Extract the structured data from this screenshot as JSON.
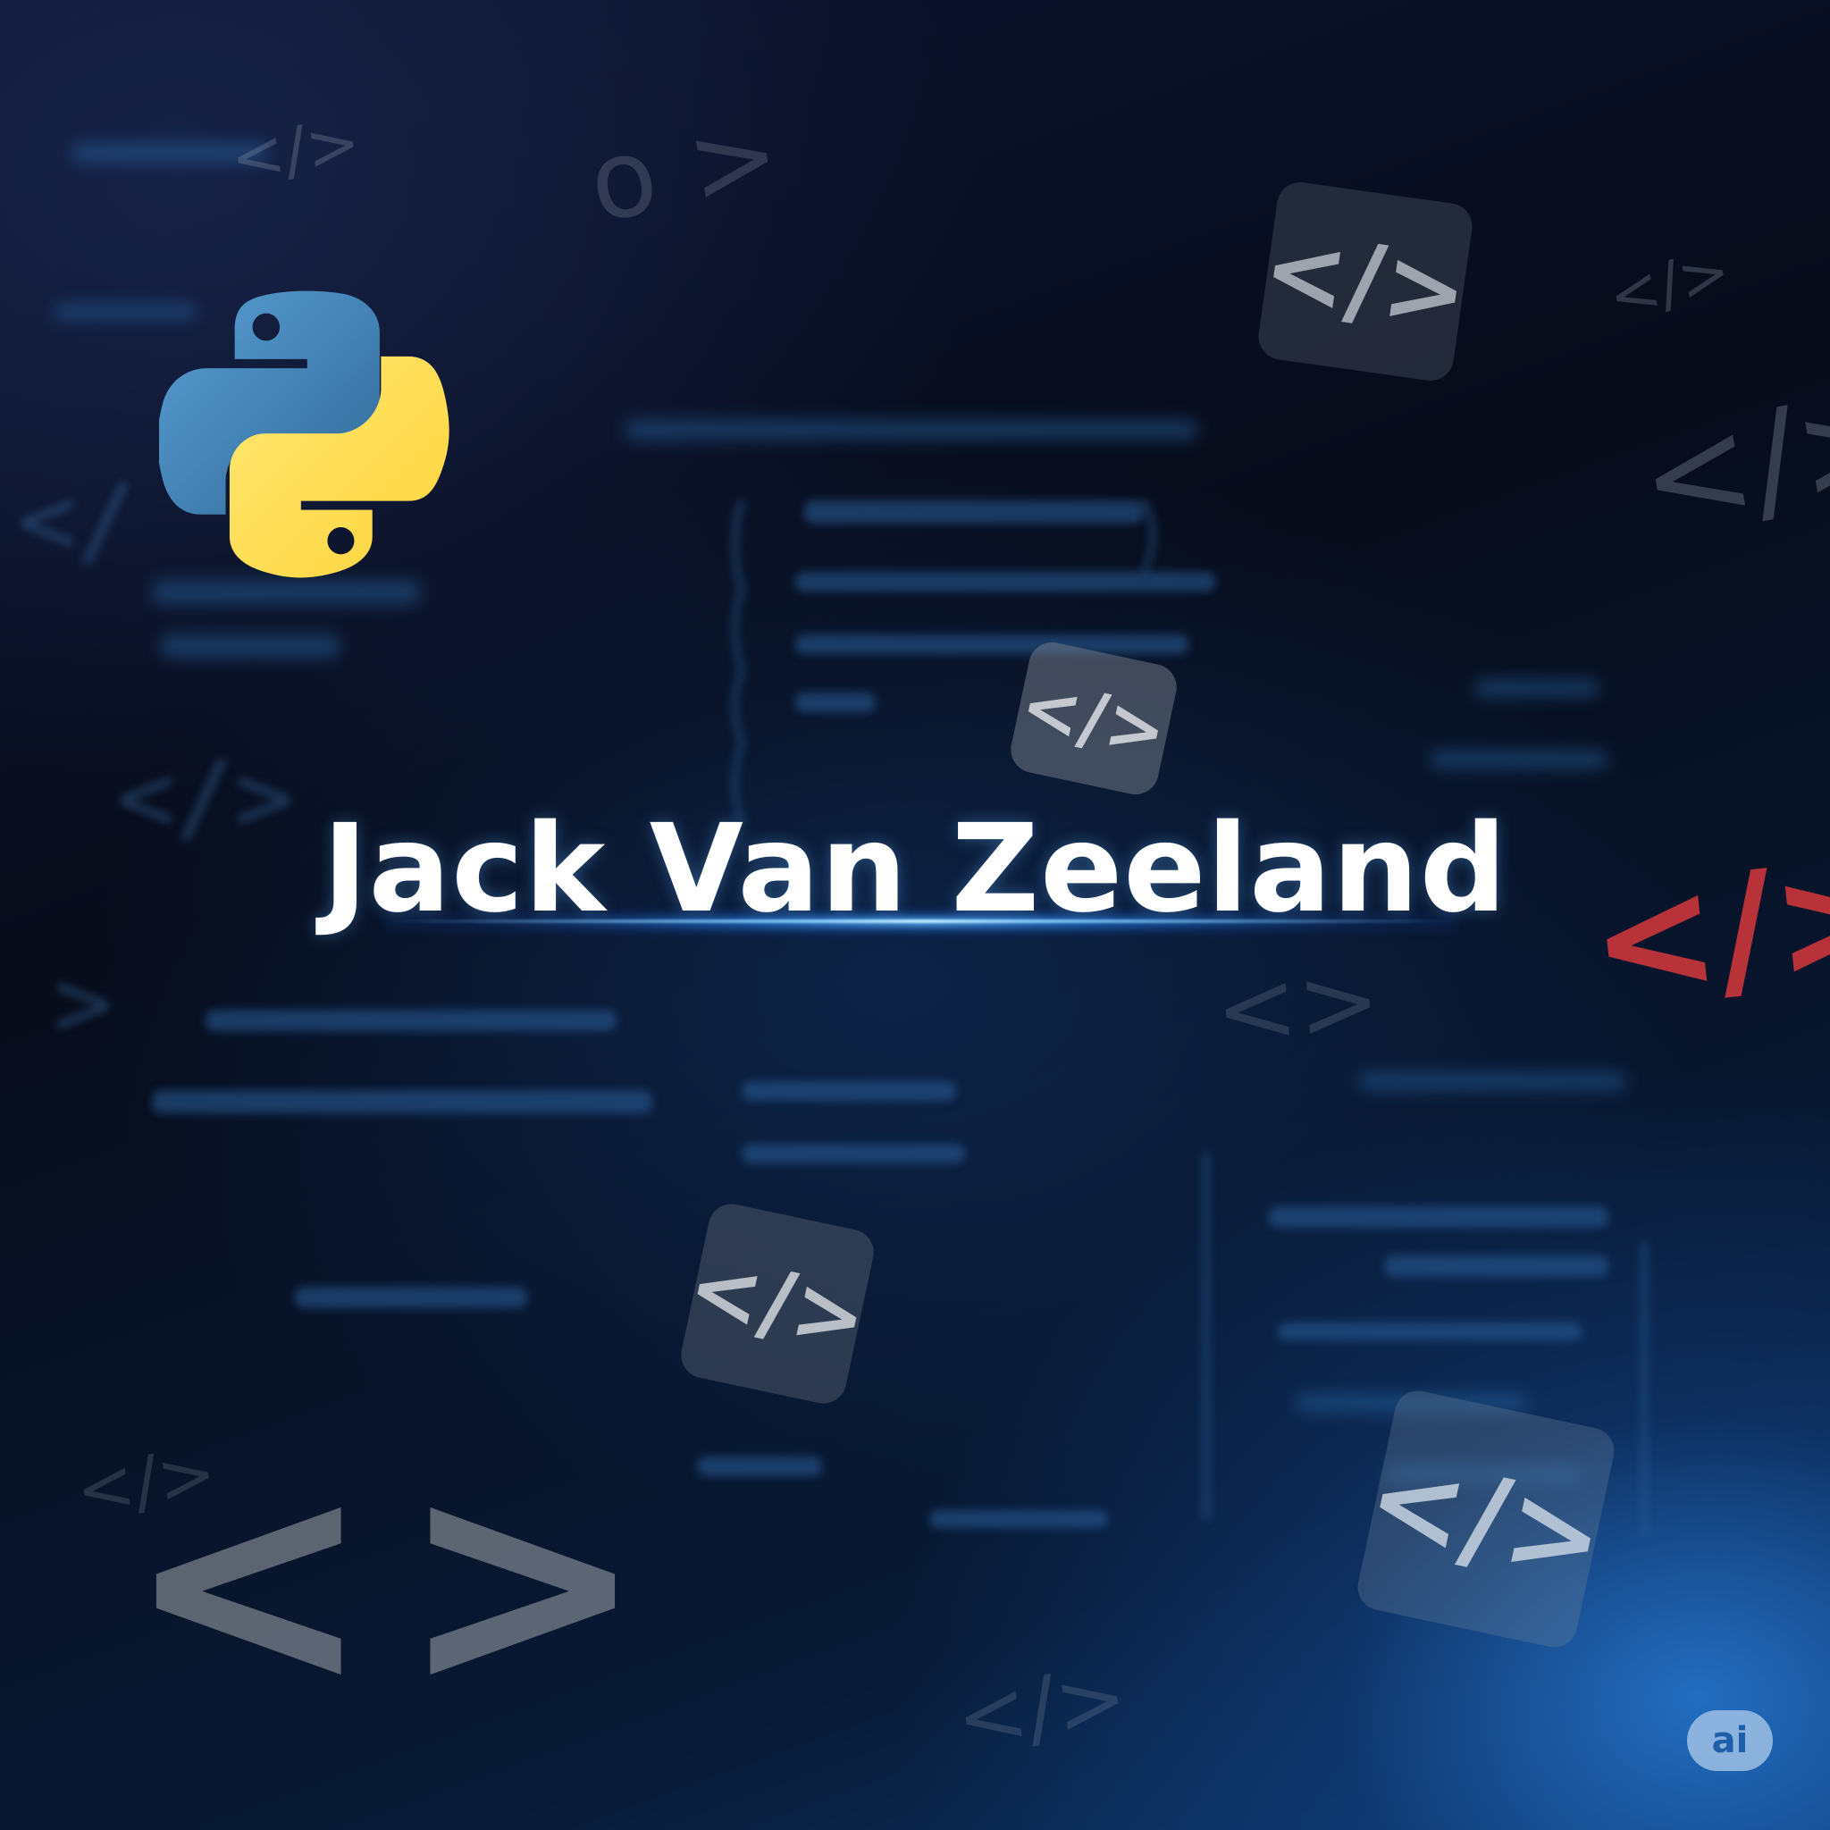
{
  "title": "Jack Van Zeeland",
  "badge": "ai",
  "icons": {
    "python_logo": "python-logo-icon",
    "code_tag": "code-tag-icon",
    "angle_brackets": "angle-brackets-icon"
  },
  "colors": {
    "python_blue": "#3f7ab3",
    "python_yellow": "#ffd343",
    "red_tag": "#b8323a",
    "title_text": "#ffffff",
    "accent_glow": "#46a8ff"
  }
}
